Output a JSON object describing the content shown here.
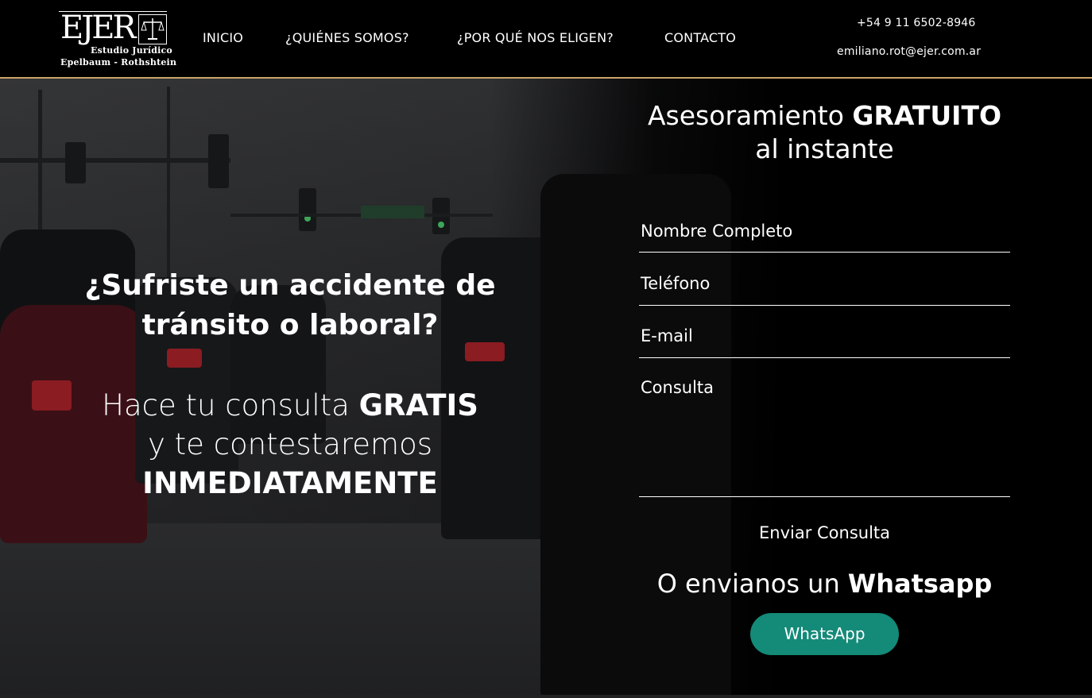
{
  "logo": {
    "title": "EJER",
    "line1": "Estudio Jurídico",
    "line2": "Epelbaum - Rothshtein",
    "icon": "scales-of-justice-icon"
  },
  "nav": {
    "items": [
      {
        "label": "INICIO"
      },
      {
        "label": "¿QUIÉNES SOMOS?"
      },
      {
        "label": "¿POR QUÉ NOS ELIGEN?"
      },
      {
        "label": "CONTACTO"
      }
    ]
  },
  "contact": {
    "phone": "+54 9 11 6502-8946",
    "email": "emiliano.rot@ejer.com.ar"
  },
  "hero": {
    "headline_line1": "¿Sufriste un accidente de",
    "headline_line2": "tránsito o laboral?",
    "sub_prefix": "Hace tu consulta ",
    "sub_bold": "GRATIS",
    "sub_line2": "y te contestaremos",
    "sub_line3": "INMEDIATAMENTE"
  },
  "form": {
    "title_prefix": "Asesoramiento ",
    "title_bold": "GRATUITO",
    "title_line2": "al instante",
    "name_placeholder": "Nombre Completo",
    "phone_placeholder": "Teléfono",
    "email_placeholder": "E-mail",
    "message_placeholder": "Consulta",
    "submit_label": "Enviar Consulta"
  },
  "whatsapp": {
    "title_prefix": "O envianos un ",
    "title_bold": "Whatsapp",
    "button_label": "WhatsApp",
    "button_color": "#148a78"
  },
  "colors": {
    "accent_line": "#c9a46a",
    "background": "#000000"
  }
}
